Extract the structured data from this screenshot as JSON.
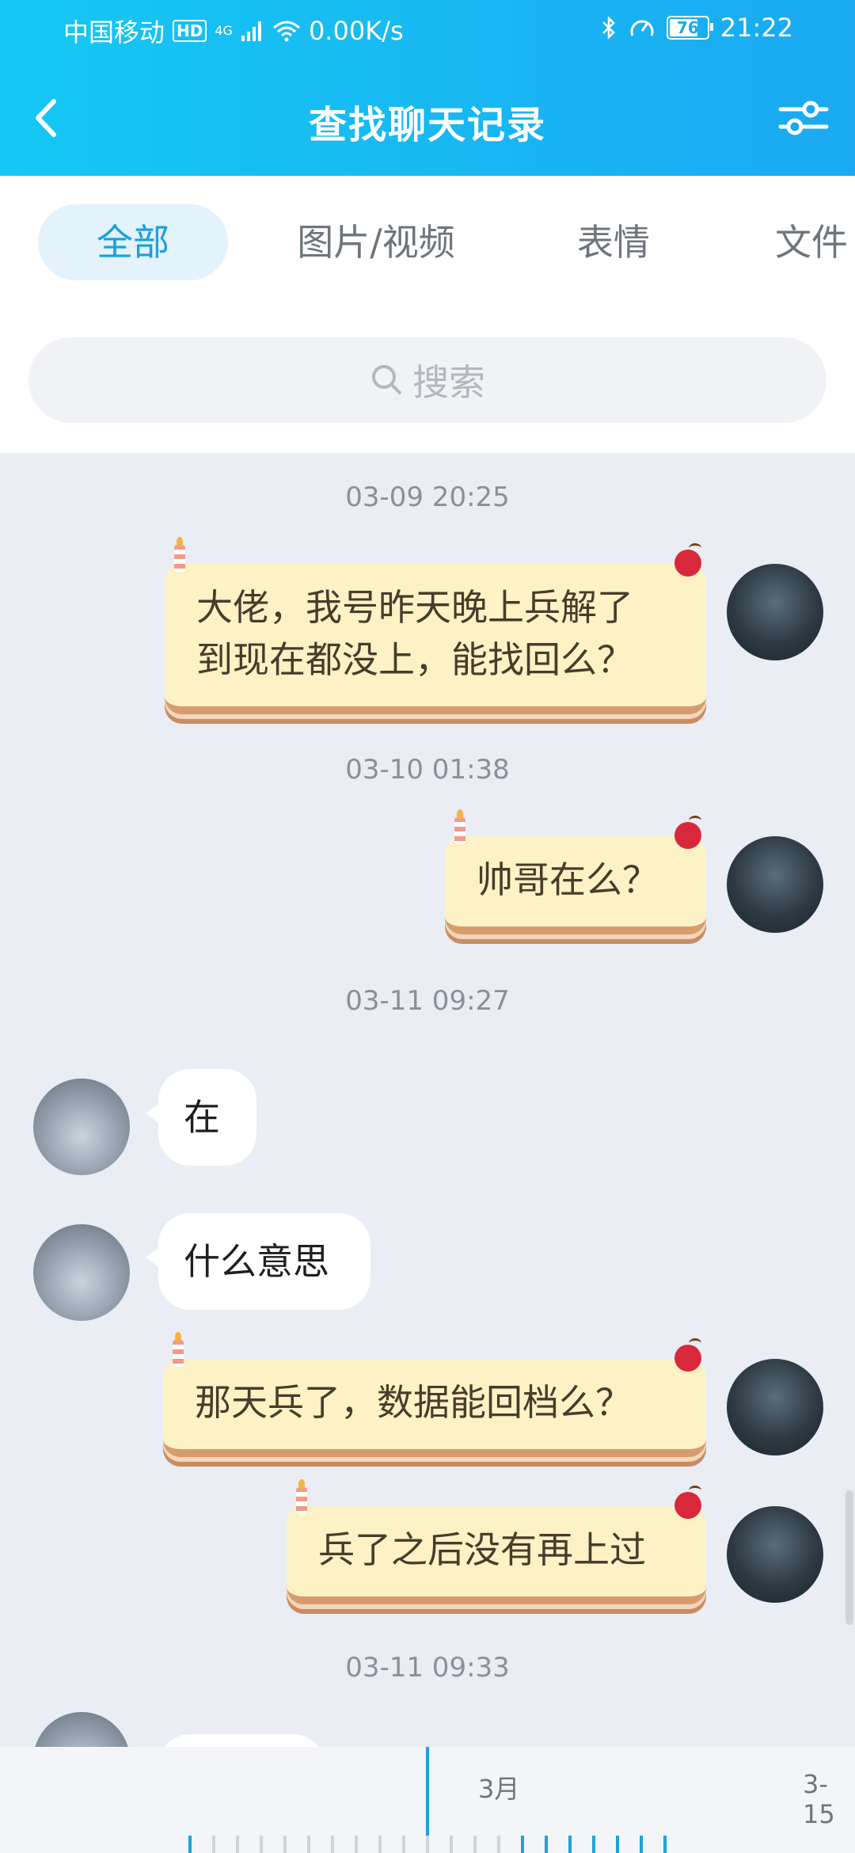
{
  "status_bar": {
    "carrier": "中国移动",
    "hd": "HD",
    "net": "4G",
    "speed": "0.00K/s",
    "battery": "76",
    "time": "21:22"
  },
  "nav": {
    "title": "查找聊天记录"
  },
  "tabs": [
    {
      "label": "全部",
      "active": true
    },
    {
      "label": "图片/视频",
      "active": false
    },
    {
      "label": "表情",
      "active": false
    },
    {
      "label": "文件",
      "active": false
    }
  ],
  "search": {
    "placeholder": "搜索"
  },
  "messages": {
    "ts1": "03-09 20:25",
    "m1_line1": "大佬，我号昨天晚上兵解了",
    "m1_line2": "到现在都没上，能找回么？",
    "ts2": "03-10 01:38",
    "m2": "帅哥在么？",
    "ts3": "03-11 09:27",
    "m3": "在",
    "m4": "什么意思",
    "m5": "那天兵了，数据能回档么？",
    "m6": "兵了之后没有再上过",
    "ts4": "03-11 09:33"
  },
  "timeline": {
    "label_month": "3月",
    "label_date": "3-15"
  },
  "colors": {
    "header_start": "#15c8f4",
    "header_end": "#1aa9f1",
    "accent": "#1ea3d9",
    "bubble": "#fdf2c6"
  }
}
